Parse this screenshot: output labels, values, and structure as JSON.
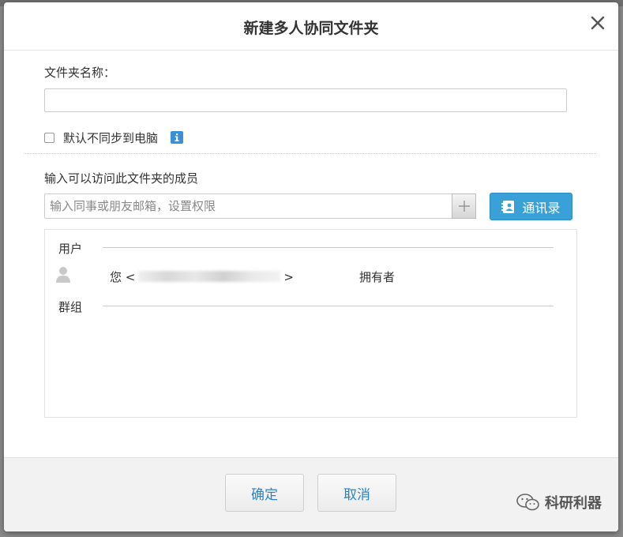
{
  "dialog": {
    "title": "新建多人协同文件夹",
    "close_icon": "close-icon"
  },
  "folder": {
    "name_label": "文件夹名称：",
    "name_value": "",
    "sync_label": "默认不同步到电脑",
    "sync_checked": false,
    "info_icon": "info-icon"
  },
  "members": {
    "label": "输入可以访问此文件夹的成员",
    "input_placeholder": "输入同事或朋友邮箱，设置权限",
    "add_icon": "plus-icon",
    "contacts_button": "通讯录",
    "contacts_icon": "address-book-icon",
    "users_heading": "用户",
    "user": {
      "name_prefix": "您 <",
      "name_suffix": ">",
      "role": "拥有者",
      "avatar_icon": "user-avatar-icon"
    },
    "groups_heading": "群组"
  },
  "footer": {
    "confirm": "确定",
    "cancel": "取消"
  },
  "watermark": {
    "text": "科研利器",
    "icon": "wechat-icon"
  },
  "colors": {
    "accent": "#3aa0d8",
    "link_text": "#2a84c4",
    "footer_bg": "#f2f2f2",
    "info": "#3a8fd8"
  }
}
